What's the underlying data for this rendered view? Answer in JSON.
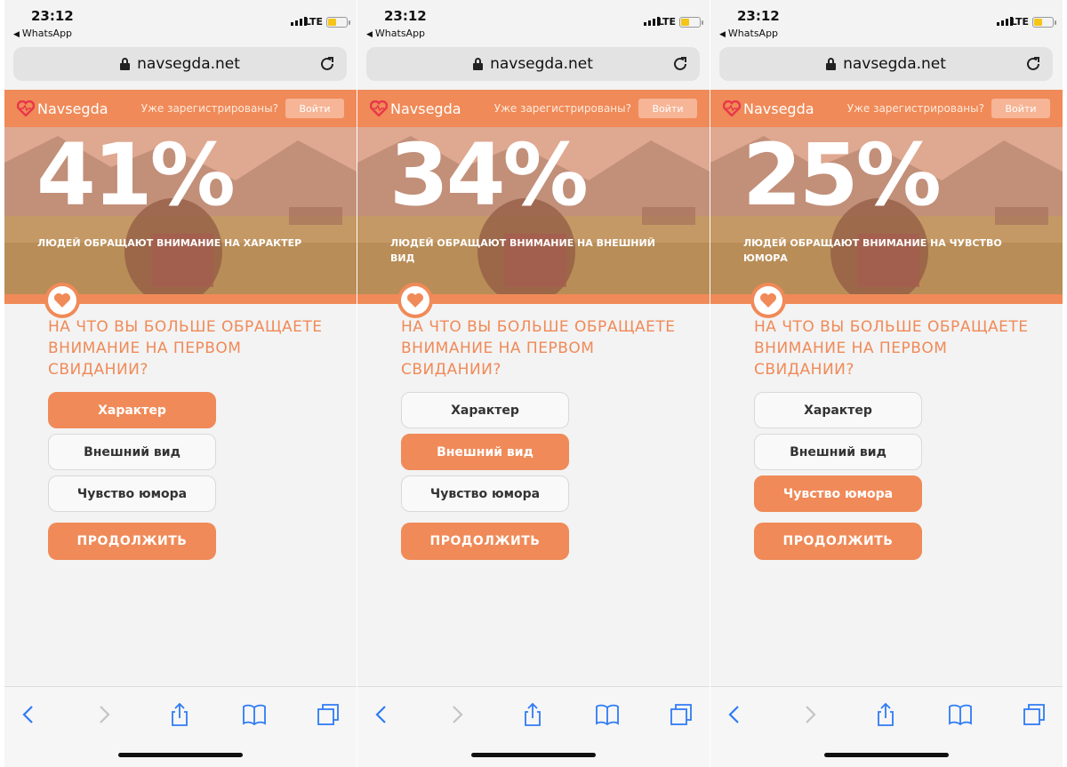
{
  "screens": [
    {
      "status": {
        "time": "23:12",
        "back_app": "WhatsApp",
        "network": "LTE"
      },
      "url": "navsegda.net",
      "header": {
        "logo": "Navsegda",
        "registered": "Уже зарегистрированы?",
        "login": "Войти"
      },
      "hero": {
        "percent": "41%",
        "caption": "ЛЮДЕЙ ОБРАЩАЮТ ВНИМАНИЕ НА ХАРАКТЕР"
      },
      "question": "НА ЧТО ВЫ БОЛЬШЕ ОБРАЩАЕТЕ ВНИМАНИЕ НА ПЕРВОМ СВИДАНИИ?",
      "options": [
        "Характер",
        "Внешний вид",
        "Чувство юмора"
      ],
      "selected_option": "Характер",
      "continue": "ПРОДОЛЖИТЬ"
    },
    {
      "status": {
        "time": "23:12",
        "back_app": "WhatsApp",
        "network": "LTE"
      },
      "url": "navsegda.net",
      "header": {
        "logo": "Navsegda",
        "registered": "Уже зарегистрированы?",
        "login": "Войти"
      },
      "hero": {
        "percent": "34%",
        "caption": "ЛЮДЕЙ ОБРАЩАЮТ ВНИМАНИЕ НА ВНЕШНИЙ ВИД"
      },
      "question": "НА ЧТО ВЫ БОЛЬШЕ ОБРАЩАЕТЕ ВНИМАНИЕ НА ПЕРВОМ СВИДАНИИ?",
      "options": [
        "Характер",
        "Внешний вид",
        "Чувство юмора"
      ],
      "selected_option": "Внешний вид",
      "continue": "ПРОДОЛЖИТЬ"
    },
    {
      "status": {
        "time": "23:12",
        "back_app": "WhatsApp",
        "network": "LTE"
      },
      "url": "navsegda.net",
      "header": {
        "logo": "Navsegda",
        "registered": "Уже зарегистрированы?",
        "login": "Войти"
      },
      "hero": {
        "percent": "25%",
        "caption": "ЛЮДЕЙ ОБРАЩАЮТ ВНИМАНИЕ НА ЧУВСТВО ЮМОРА"
      },
      "question": "НА ЧТО ВЫ БОЛЬШЕ ОБРАЩАЕТЕ ВНИМАНИЕ НА ПЕРВОМ СВИДАНИИ?",
      "options": [
        "Характер",
        "Внешний вид",
        "Чувство юмора"
      ],
      "selected_option": "Чувство юмора",
      "continue": "ПРОДОЛЖИТЬ"
    }
  ],
  "colors": {
    "accent": "#f08a58",
    "accent_light": "#f6b596",
    "toolbar_icon": "#2f7bf5"
  },
  "icons": [
    "lock-icon",
    "reload-icon",
    "heart-logo-icon",
    "heart-icon",
    "back-icon",
    "forward-icon",
    "share-icon",
    "bookmarks-icon",
    "tabs-icon"
  ]
}
